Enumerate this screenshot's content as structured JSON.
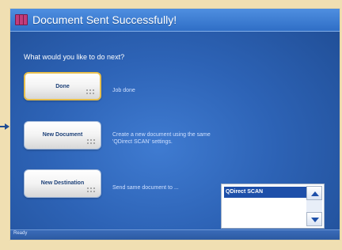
{
  "window": {
    "title": "Document Sent Successfully!",
    "prompt": "What would you like to do next?"
  },
  "actions": [
    {
      "label": "Done",
      "description": "Job done"
    },
    {
      "label": "New Document",
      "description_line1": "Create a new document using the same",
      "description_line2": "'QDirect SCAN' settings."
    },
    {
      "label": "New Destination",
      "description": "Send same document to ..."
    }
  ],
  "destinations": {
    "items": [
      "QDirect SCAN"
    ],
    "selected": "QDirect SCAN"
  },
  "status": {
    "text": "Ready"
  },
  "icons": {
    "app": "books-app-icon",
    "grip": "dots-grip-icon",
    "scroll_up": "triangle-up-icon",
    "scroll_down": "triangle-down-icon",
    "pointer": "arrow-right-icon"
  },
  "colors": {
    "accent": "#2d63b6",
    "selection": "#1d4fa9",
    "focus": "#e7bf4e"
  }
}
